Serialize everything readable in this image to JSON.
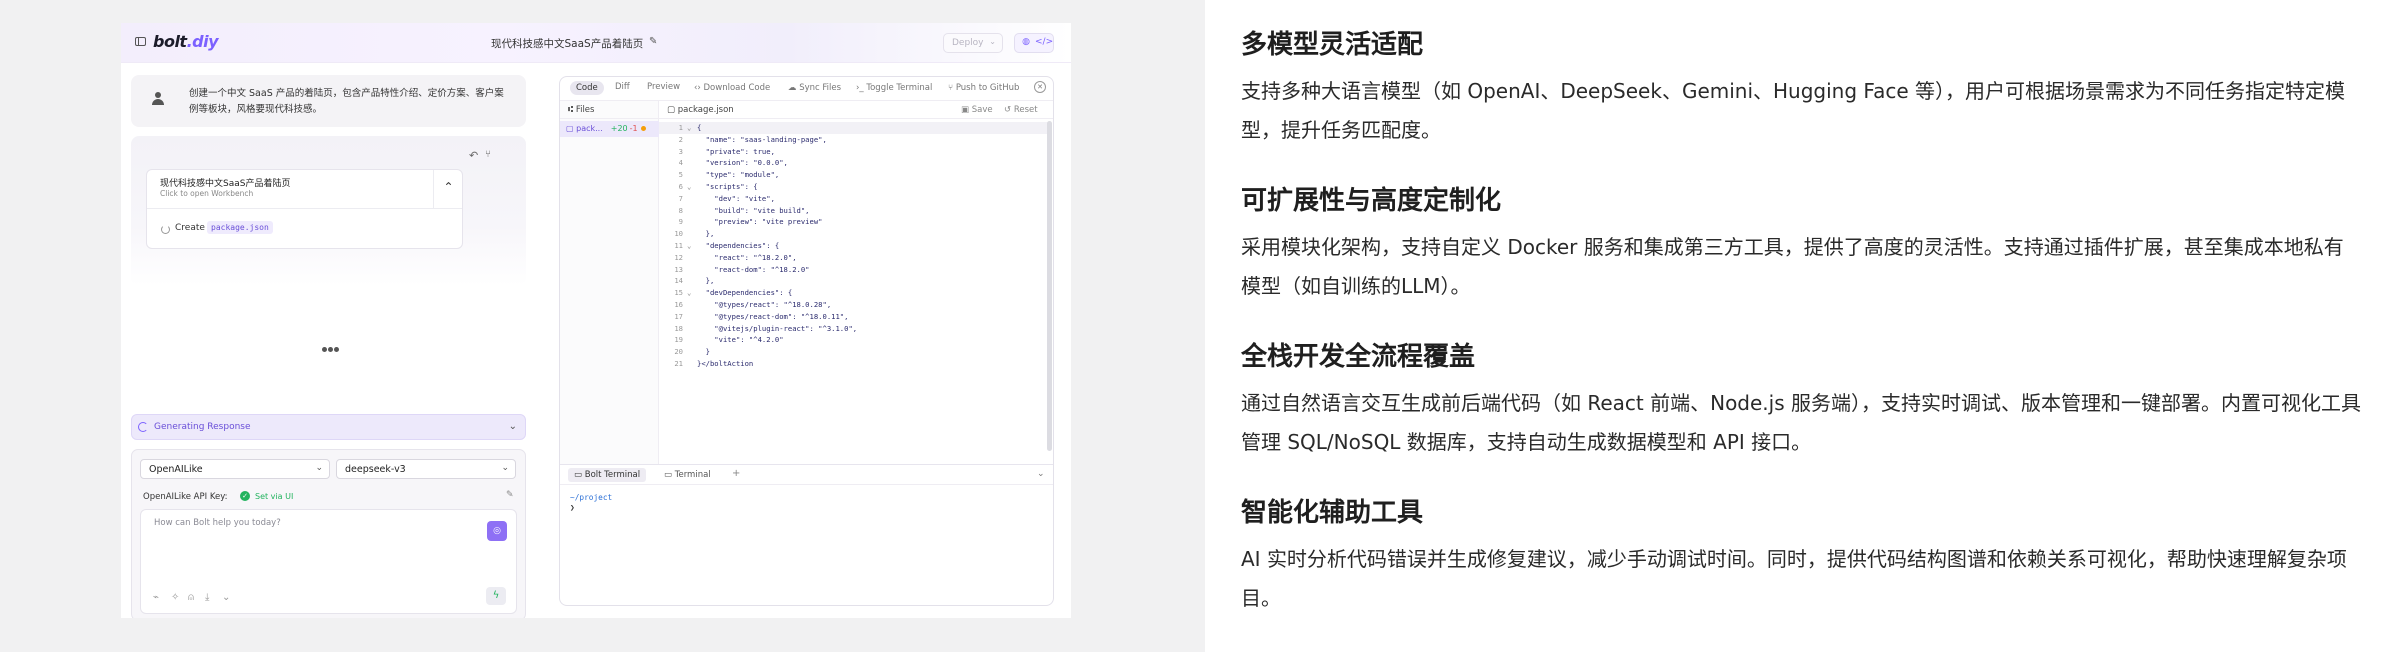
{
  "app": {
    "logo_main": "bolt",
    "logo_accent": ".diy",
    "chat_title": "现代科技感中文SaaS产品着陆页",
    "deploy_label": "Deploy",
    "view_icons": [
      "chat-icon",
      "code-icon"
    ]
  },
  "chat": {
    "user_message": "创建一个中文 SaaS 产品的着陆页，包含产品特性介绍、定价方案、客户案例等板块，风格要现代科技感。",
    "artifact": {
      "title": "现代科技感中文SaaS产品着陆页",
      "subtitle": "Click to open Workbench",
      "action_label": "Create",
      "action_file": "package.json"
    },
    "generating_label": "Generating Response",
    "provider": "OpenAILike",
    "model": "deepseek-v3",
    "api_key_label": "OpenAILike API Key:",
    "api_key_status": "Set via UI",
    "prompt_placeholder": "How can Bolt help you today?"
  },
  "workbench": {
    "tabs": [
      "Code",
      "Diff",
      "Preview"
    ],
    "actions": [
      "Download Code",
      "Sync Files",
      "Toggle Terminal",
      "Push to GitHub"
    ],
    "files_header": "Files",
    "file": {
      "name": "pack...",
      "added": "+20",
      "removed": "-1"
    },
    "editor_file": "package.json",
    "save_label": "Save",
    "reset_label": "Reset",
    "code_lines": [
      {
        "n": "1",
        "fold": "⌄",
        "text": "{"
      },
      {
        "n": "2",
        "fold": "",
        "text": "  \"name\": \"saas-landing-page\","
      },
      {
        "n": "3",
        "fold": "",
        "text": "  \"private\": true,"
      },
      {
        "n": "4",
        "fold": "",
        "text": "  \"version\": \"0.0.0\","
      },
      {
        "n": "5",
        "fold": "",
        "text": "  \"type\": \"module\","
      },
      {
        "n": "6",
        "fold": "⌄",
        "text": "  \"scripts\": {"
      },
      {
        "n": "7",
        "fold": "",
        "text": "    \"dev\": \"vite\","
      },
      {
        "n": "8",
        "fold": "",
        "text": "    \"build\": \"vite build\","
      },
      {
        "n": "9",
        "fold": "",
        "text": "    \"preview\": \"vite preview\""
      },
      {
        "n": "10",
        "fold": "",
        "text": "  },"
      },
      {
        "n": "11",
        "fold": "⌄",
        "text": "  \"dependencies\": {"
      },
      {
        "n": "12",
        "fold": "",
        "text": "    \"react\": \"^18.2.0\","
      },
      {
        "n": "13",
        "fold": "",
        "text": "    \"react-dom\": \"^18.2.0\""
      },
      {
        "n": "14",
        "fold": "",
        "text": "  },"
      },
      {
        "n": "15",
        "fold": "⌄",
        "text": "  \"devDependencies\": {"
      },
      {
        "n": "16",
        "fold": "",
        "text": "    \"@types/react\": \"^18.0.28\","
      },
      {
        "n": "17",
        "fold": "",
        "text": "    \"@types/react-dom\": \"^18.0.11\","
      },
      {
        "n": "18",
        "fold": "",
        "text": "    \"@vitejs/plugin-react\": \"^3.1.0\","
      },
      {
        "n": "19",
        "fold": "",
        "text": "    \"vite\": \"^4.2.0\""
      },
      {
        "n": "20",
        "fold": "",
        "text": "  }"
      },
      {
        "n": "21",
        "fold": "",
        "text": "}</boltAction"
      }
    ],
    "terminal_tabs": [
      "Bolt Terminal",
      "Terminal"
    ],
    "terminal_path": "~/project",
    "terminal_prompt": "❯"
  },
  "article": [
    {
      "title": "多模型灵活适配",
      "body": "支持多种大语言模型（如 OpenAI、DeepSeek、Gemini、Hugging Face 等），用户可根据场景需求为不同任务指定特定模型，提升任务匹配度。"
    },
    {
      "title": "可扩展性与高度定制化",
      "body": "采用模块化架构，支持自定义 Docker 服务和集成第三方工具，提供了高度的灵活性。支持通过插件扩展，甚至集成本地私有模型（如自训练的LLM）。"
    },
    {
      "title": "全栈开发全流程覆盖",
      "body": "通过自然语言交互生成前后端代码（如 React 前端、Node.js 服务端），支持实时调试、版本管理和一键部署。内置可视化工具管理 SQL/NoSQL 数据库，支持自动生成数据模型和 API 接口。"
    },
    {
      "title": "智能化辅助工具",
      "body": "AI 实时分析代码错误并生成修复建议，减少手动调试时间。同时，提供代码结构图谱和依赖关系可视化，帮助快速理解复杂项目。"
    }
  ],
  "colors": {
    "accent": "#7b61ff",
    "success": "#22b35e"
  }
}
